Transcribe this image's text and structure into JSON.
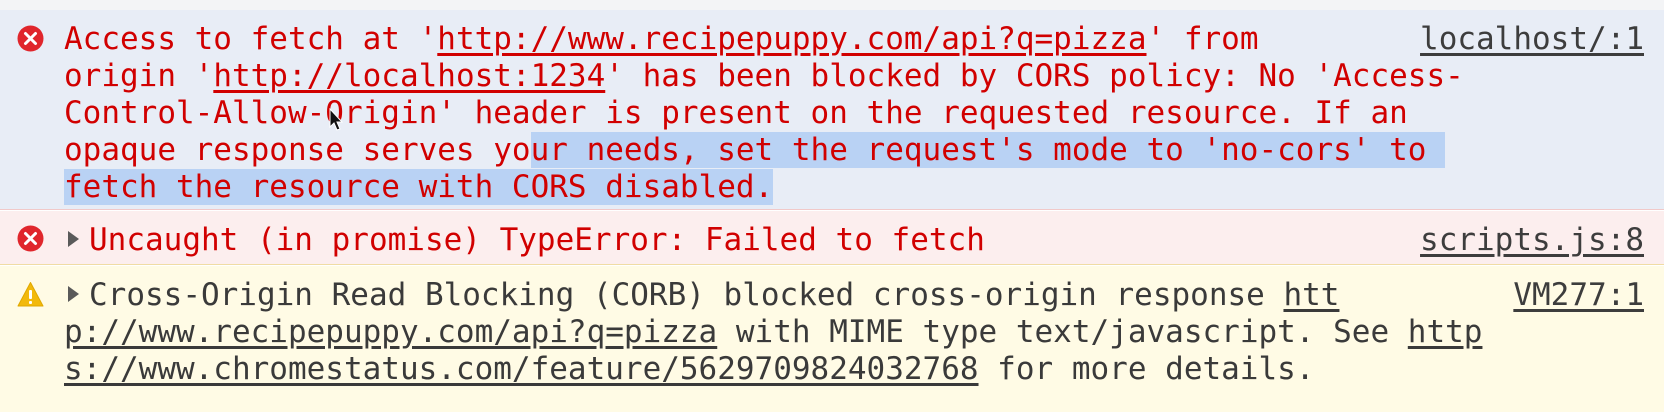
{
  "messages": [
    {
      "level": "error",
      "icon": "error-circle-icon",
      "source": "localhost/:1",
      "lines": [
        {
          "a": "Access to fetch at '",
          "url": "http://www.recipepuppy.com/api?q=pizza",
          "b": "' from"
        },
        {
          "a": "origin '",
          "url": "http://localhost:1234",
          "b": "' has been blocked by CORS policy: No 'Access-"
        },
        {
          "a": "Control-Allow-Origin' header is present on the requested resource. If an"
        },
        {
          "a": "opaque response serves yo",
          "sel": "ur needs, set the request's mode to 'no-cors' to "
        },
        {
          "sel": "fetch the resource with CORS disabled."
        }
      ]
    },
    {
      "level": "error",
      "icon": "error-circle-icon",
      "text": "Uncaught (in promise) TypeError: Failed to fetch",
      "source": "scripts.js:8"
    },
    {
      "level": "warning",
      "icon": "warning-triangle-icon",
      "source": "VM277:1",
      "lines": [
        {
          "a": "Cross-Origin Read Blocking (CORB) blocked cross-origin response ",
          "link": "htt"
        },
        {
          "link": "p://www.recipepuppy.com/api?q=pizza",
          "b": " with MIME type text/javascript. See ",
          "link2": "http"
        },
        {
          "link": "s://www.chromestatus.com/feature/5629709824032768",
          "b": " for more details."
        }
      ]
    }
  ],
  "colors": {
    "error_text": "#d10000",
    "error_bg": "#fceeee",
    "selected_bg": "#e8edf6",
    "warning_bg": "#fffbe5",
    "selection": "#b9d2f4"
  }
}
